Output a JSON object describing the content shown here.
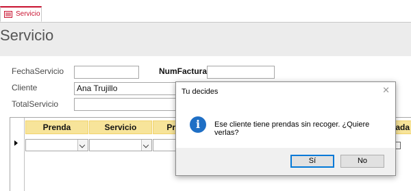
{
  "tab": {
    "label": "Servicio",
    "icon": "form-icon"
  },
  "form": {
    "title": "Servicio",
    "labels": {
      "fecha": "FechaServicio",
      "numfactura": "NumFactura",
      "cliente": "Cliente",
      "total": "TotalServicio"
    },
    "values": {
      "fecha": "",
      "numfactura": "",
      "cliente": "Ana Trujillo",
      "total": ""
    }
  },
  "subform": {
    "columns": [
      "Prenda",
      "Servicio",
      "Pre",
      "gada"
    ]
  },
  "dialog": {
    "title": "Tu decides",
    "message": "Ese cliente tiene prendas sin recoger. ¿Quiere verlas?",
    "yes_label": "Sí",
    "no_label": "No",
    "close_glyph": "✕",
    "icon_glyph": "i",
    "icon_color": "#1f6fc5"
  },
  "colors": {
    "header_band": "#ececec",
    "column_header": "#f7e49a",
    "tab_accent": "#c8102e"
  }
}
